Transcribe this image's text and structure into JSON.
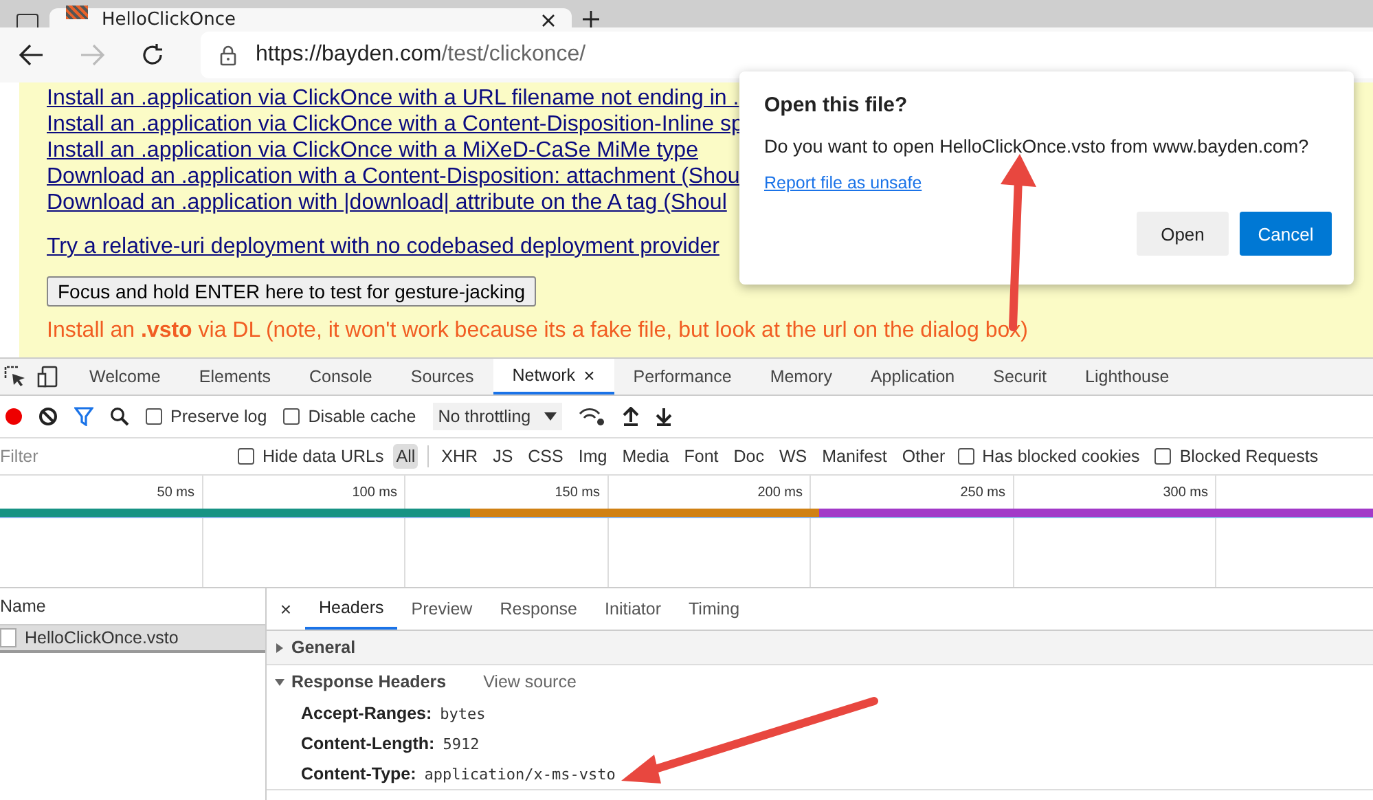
{
  "browser": {
    "tab_title": "HelloClickOnce",
    "url_host": "https://bayden.com",
    "url_path": "/test/clickonce/"
  },
  "page": {
    "links": [
      "Install an .application via ClickOnce with a URL filename not ending in .",
      "Install an .application via ClickOnce with a Content-Disposition-Inline sp",
      "Install an .application via ClickOnce with a MiXeD-CaSe MiMe type",
      "Download an .application with a Content-Disposition: attachment (Shou",
      "Download an .application with |download| attribute on the A tag (Shoul"
    ],
    "relative_link": "Try a relative-uri deployment with no codebased deployment provider",
    "button": "Focus and hold ENTER here to test for gesture-jacking",
    "note": "Install an **.vsto** via DL (note, it won't work because its a fake file, but look at the url on the dialog box)"
  },
  "dialog": {
    "title": "Open this file?",
    "message": "Do you want to open HelloClickOnce.vsto from www.bayden.com?",
    "report_link": "Report file as unsafe",
    "buttons": [
      {
        "label": "Open",
        "primary": false
      },
      {
        "label": "Cancel",
        "primary": true
      }
    ]
  },
  "devtools": {
    "tabs": [
      {
        "label": "Welcome",
        "selected": false
      },
      {
        "label": "Elements",
        "selected": false
      },
      {
        "label": "Console",
        "selected": false
      },
      {
        "label": "Sources",
        "selected": false
      },
      {
        "label": "Network",
        "selected": true
      },
      {
        "label": "Performance",
        "selected": false
      },
      {
        "label": "Memory",
        "selected": false
      },
      {
        "label": "Application",
        "selected": false
      },
      {
        "label": "Securit",
        "selected": false
      },
      {
        "label": "Lighthouse",
        "selected": false
      }
    ],
    "close_tab": "×",
    "toolbar": {
      "recording": true,
      "preserve_log": {
        "label": "Preserve log",
        "checked": false
      },
      "disable_cache": {
        "label": "Disable cache",
        "checked": false
      },
      "throttling": "No throttling"
    },
    "filter": {
      "placeholder": "Filter",
      "hide_data_urls": {
        "label": "Hide data URLs",
        "checked": false
      },
      "types": [
        {
          "label": "All",
          "selected": true
        },
        {
          "label": "XHR",
          "selected": false
        },
        {
          "label": "JS",
          "selected": false
        },
        {
          "label": "CSS",
          "selected": false
        },
        {
          "label": "Img",
          "selected": false
        },
        {
          "label": "Media",
          "selected": false
        },
        {
          "label": "Font",
          "selected": false
        },
        {
          "label": "Doc",
          "selected": false
        },
        {
          "label": "WS",
          "selected": false
        },
        {
          "label": "Manifest",
          "selected": false
        },
        {
          "label": "Other",
          "selected": false
        }
      ],
      "checks": [
        {
          "label": "Has blocked cookies",
          "checked": false
        },
        {
          "label": "Blocked Requests",
          "checked": false
        }
      ]
    },
    "timeline_ticks": [
      "50 ms",
      "100 ms",
      "150 ms",
      "200 ms",
      "250 ms",
      "300 ms"
    ],
    "requests": {
      "column": "Name",
      "rows": [
        {
          "name": "HelloClickOnce.vsto",
          "selected": true
        }
      ]
    },
    "details": {
      "close": "×",
      "tabs": [
        {
          "label": "Headers",
          "selected": true
        },
        {
          "label": "Preview",
          "selected": false
        },
        {
          "label": "Response",
          "selected": false
        },
        {
          "label": "Initiator",
          "selected": false
        },
        {
          "label": "Timing",
          "selected": false
        }
      ],
      "sections": [
        {
          "title": "General",
          "expanded": false
        },
        {
          "title": "Response Headers",
          "expanded": true,
          "action": "View source",
          "headers": [
            {
              "name": "Accept-Ranges:",
              "value": "bytes"
            },
            {
              "name": "Content-Length:",
              "value": "5912"
            },
            {
              "name": "Content-Type:",
              "value": "application/x-ms-vsto"
            }
          ]
        }
      ]
    }
  }
}
